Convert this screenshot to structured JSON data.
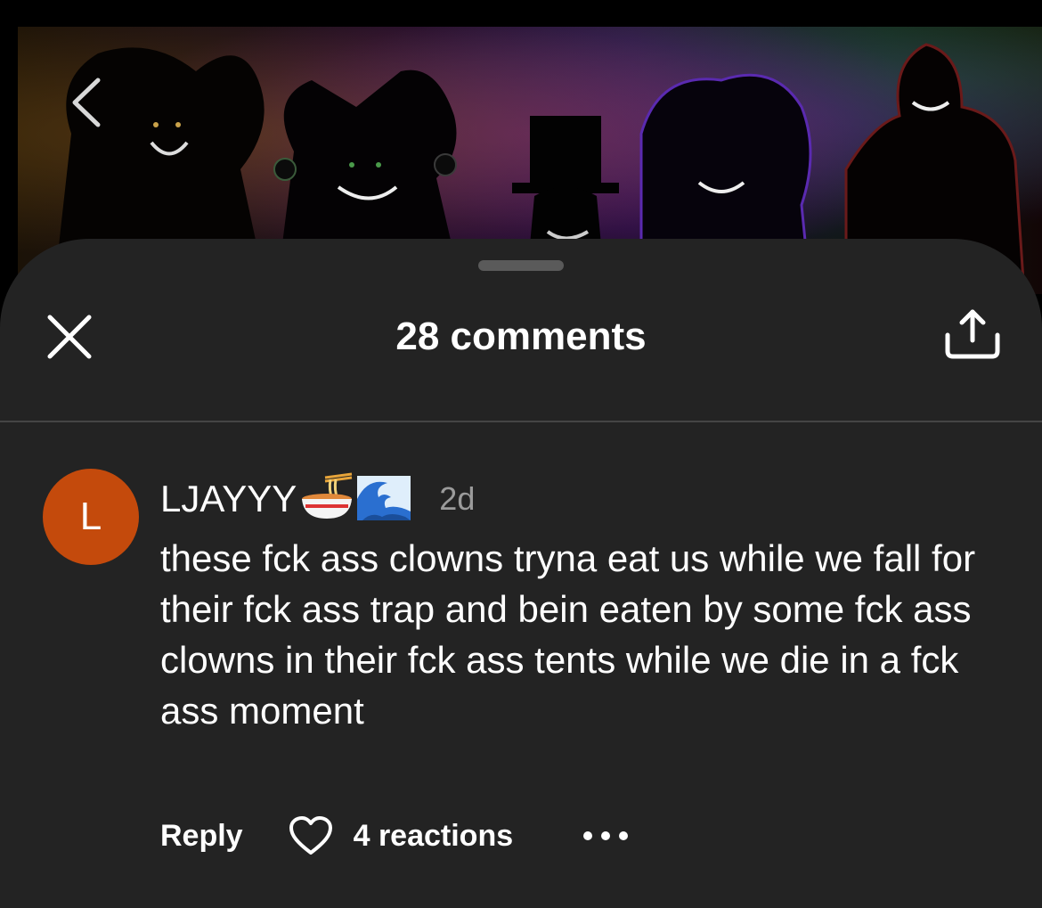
{
  "header": {
    "back_icon": "chevron-left-icon"
  },
  "sheet": {
    "title": "28 comments",
    "close_icon": "close-icon",
    "share_icon": "share-upload-icon"
  },
  "comment": {
    "avatar_letter": "L",
    "avatar_color": "#c44a0c",
    "username": "LJAYYY",
    "username_emoji": [
      "ramen-bowl-icon",
      "wave-icon"
    ],
    "timestamp": "2d",
    "text": "these fck ass clowns tryna eat us while we fall for their fck ass trap and bein eaten by some fck ass clowns in their fck ass tents while we die in a fck ass moment",
    "reply_label": "Reply",
    "reactions_label": "4 reactions",
    "like_icon": "heart-outline-icon",
    "more_icon": "more-horizontal-icon"
  },
  "colors": {
    "sheet_background": "#232323",
    "text_primary": "#ffffff",
    "text_secondary": "#9b9b9b"
  }
}
